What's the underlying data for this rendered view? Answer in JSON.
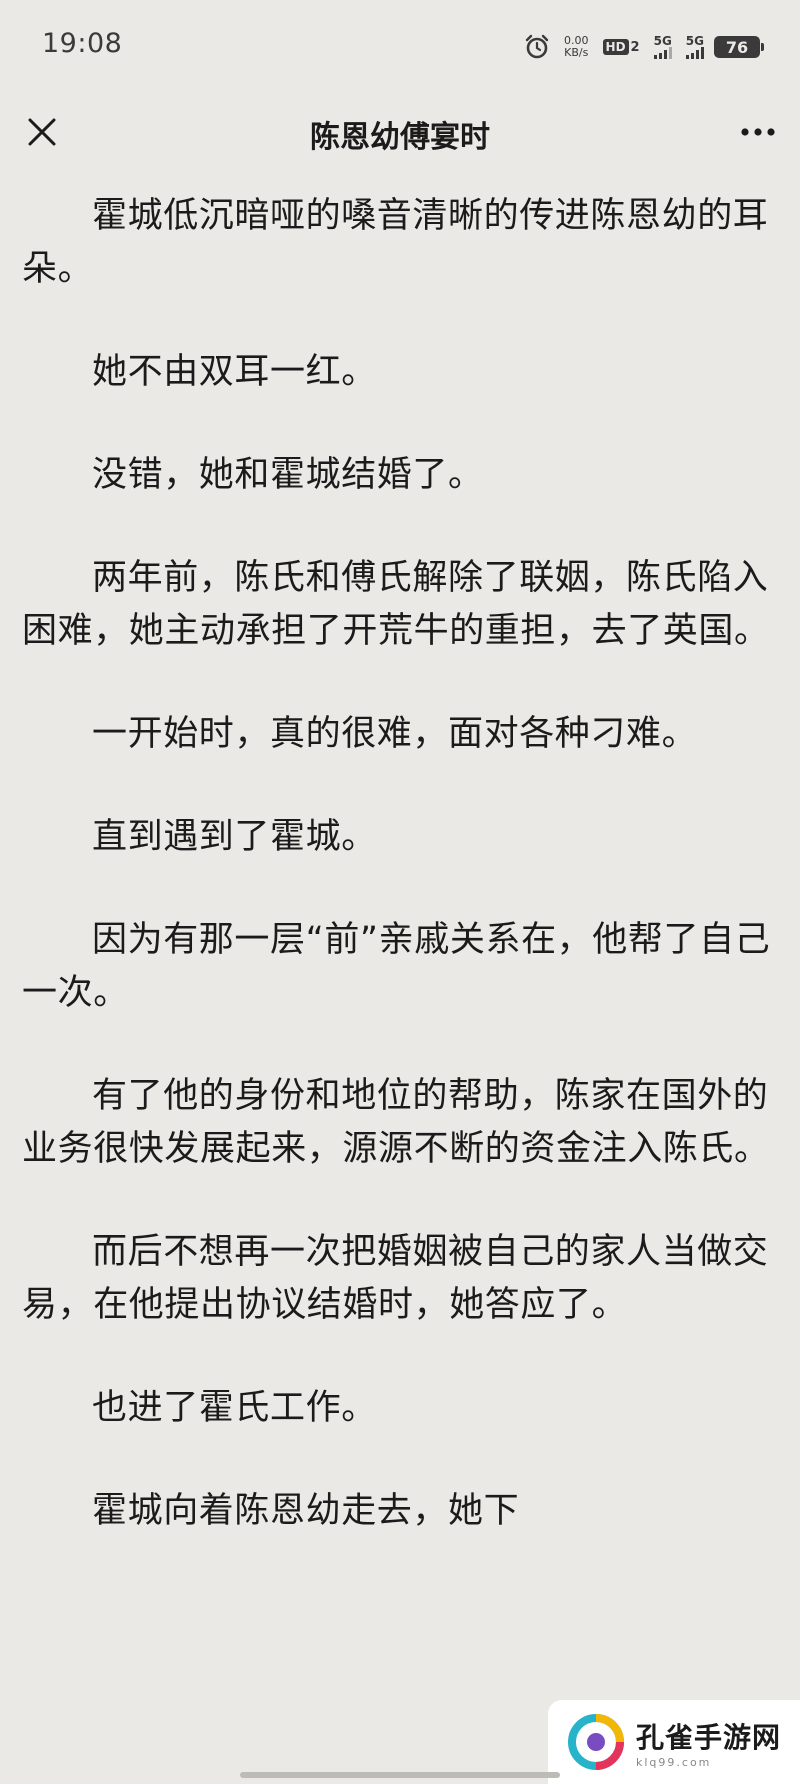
{
  "status_bar": {
    "time": "19:08",
    "speed_value": "0.00",
    "speed_unit": "KB/s",
    "hd_label": "HD",
    "hd_sub": "2",
    "sim1_label": "5G",
    "sim2_label": "5G",
    "battery": "76"
  },
  "header": {
    "title": "陈恩幼傅宴时"
  },
  "content": {
    "paragraphs": [
      "霍城低沉暗哑的嗓音清晰的传进陈恩幼的耳朵。",
      "她不由双耳一红。",
      "没错，她和霍城结婚了。",
      "两年前，陈氏和傅氏解除了联姻，陈氏陷入困难，她主动承担了开荒牛的重担，去了英国。",
      "一开始时，真的很难，面对各种刁难。",
      "直到遇到了霍城。",
      "因为有那一层“前”亲戚关系在，他帮了自己一次。",
      "有了他的身份和地位的帮助，陈家在国外的业务很快发展起来，源源不断的资金注入陈氏。",
      "而后不想再一次把婚姻被自己的家人当做交易，在他提出协议结婚时，她答应了。",
      "也进了霍氏工作。",
      "霍城向着陈恩幼走去，她下"
    ]
  },
  "watermark": {
    "name": "孔雀手游网",
    "url": "klq99.com"
  }
}
